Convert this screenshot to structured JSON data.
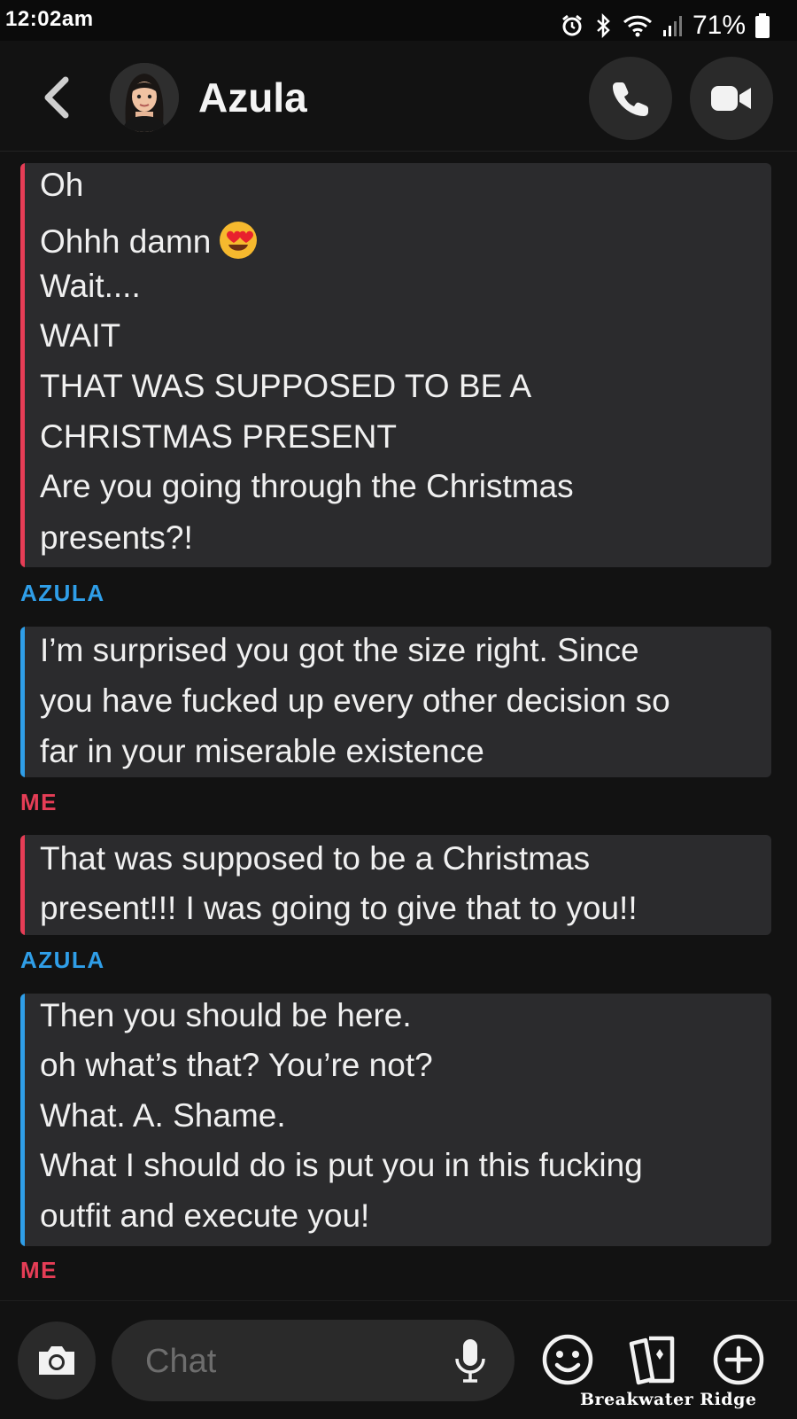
{
  "status_bar": {
    "time": "12:02am",
    "battery": "71%"
  },
  "header": {
    "contact_name": "Azula"
  },
  "messages": {
    "block1_lines": [
      "Oh",
      "Ohhh damn",
      "Wait....",
      "WAIT",
      "THAT WAS SUPPOSED TO BE A",
      "CHRISTMAS PRESENT",
      "Are you going through the Christmas",
      "presents?!"
    ],
    "sender_azula_1": "AZULA",
    "block2_lines": [
      "I’m surprised you got the size right. Since",
      "you have fucked up every other decision so",
      "far in your miserable existence"
    ],
    "sender_me_1": "ME",
    "block3_lines": [
      "That was supposed to be a Christmas",
      "present!!! I was going to give that to you!!"
    ],
    "sender_azula_2": "AZULA",
    "block4_lines": [
      "Then you should be here.",
      "oh what’s that? You’re not?",
      "What. A. Shame.",
      "What I should do is put you in this fucking",
      "outfit and execute you!"
    ],
    "sender_me_2": "ME"
  },
  "composer": {
    "placeholder": "Chat"
  },
  "watermark": "Breakwater Ridge",
  "colors": {
    "me_accent": "#e63d56",
    "azula_accent": "#2f9ee8",
    "bubble_bg": "#2b2b2d",
    "background": "#121212"
  },
  "icons": [
    "back-arrow-icon",
    "phone-icon",
    "video-camera-icon",
    "camera-icon",
    "microphone-icon",
    "smiley-icon",
    "cards-icon",
    "plus-icon",
    "alarm-icon",
    "bluetooth-icon",
    "wifi-icon",
    "signal-icon",
    "battery-icon"
  ]
}
